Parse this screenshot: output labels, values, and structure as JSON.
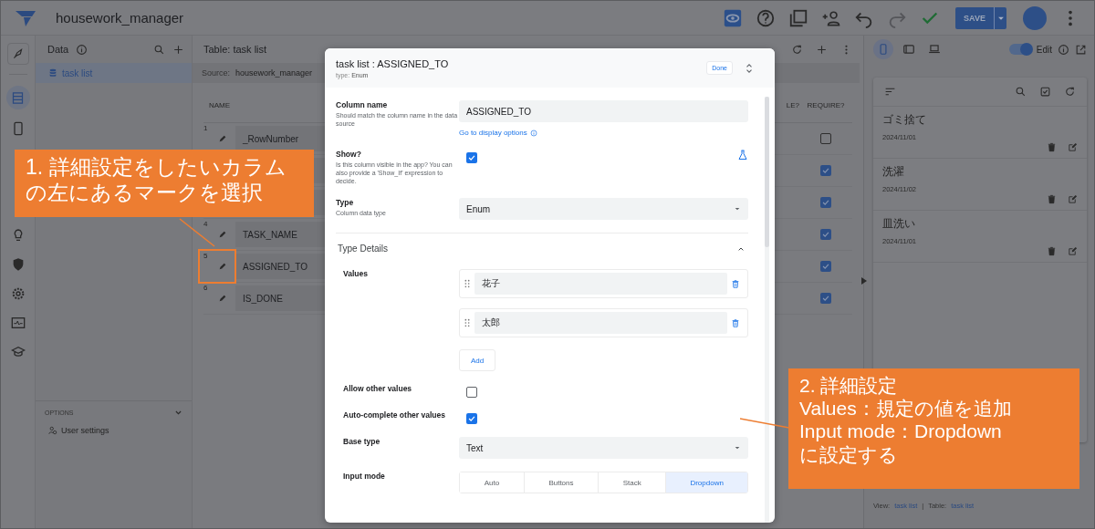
{
  "app": {
    "title": "housework_manager",
    "save_label": "SAVE"
  },
  "data_panel": {
    "title": "Data",
    "tables": [
      {
        "label": "task list",
        "selected": true
      }
    ],
    "options_title": "OPTIONS",
    "options_items": [
      "User settings"
    ]
  },
  "table_panel": {
    "title": "Table: task list",
    "source_label": "Source:",
    "source_value": "housework_manager",
    "columns": [
      "NAME",
      "LE?",
      "REQUIRE?"
    ],
    "rows": [
      {
        "number": "1",
        "name": "_RowNumber",
        "require": false
      },
      {
        "require": true
      },
      {
        "require": true
      },
      {
        "number": "4",
        "name": "TASK_NAME",
        "require": true
      },
      {
        "number": "5",
        "name": "ASSIGNED_TO",
        "require": true
      },
      {
        "number": "6",
        "name": "IS_DONE",
        "require": true
      }
    ]
  },
  "preview": {
    "devices": [
      {
        "kind": "phone",
        "selected": true
      },
      {
        "kind": "tablet",
        "selected": false
      },
      {
        "kind": "laptop",
        "selected": false
      }
    ],
    "edit_on": true,
    "edit_label": "Edit",
    "items": [
      {
        "title": "ゴミ捨て",
        "date": "2024/11/01"
      },
      {
        "title": "洗濯",
        "date": "2024/11/02"
      },
      {
        "title": "皿洗い",
        "date": "2024/11/01"
      }
    ],
    "footer": {
      "view_label": "View:",
      "view_value": "task list",
      "separator": "|",
      "table_label": "Table:",
      "table_value": "task list"
    }
  },
  "dialog": {
    "title": "task list : ASSIGNED_TO",
    "type_label": "type:",
    "type_value": "Enum",
    "done_label": "Done",
    "fields": [
      {
        "kind": "text",
        "label": "Column name",
        "description": "Should match the column name in the data source",
        "value": "ASSIGNED_TO",
        "link": "Go to display options"
      },
      {
        "kind": "checkbox",
        "label": "Show?",
        "description": "Is this column visible in the app? You can also provide a 'Show_If' expression to decide.",
        "checked": true
      },
      {
        "kind": "select",
        "label": "Type",
        "description": "Column data type",
        "value": "Enum"
      }
    ],
    "section": {
      "title": "Type Details",
      "expanded": true,
      "items": [
        {
          "kind": "values",
          "label": "Values",
          "values": [
            "花子",
            "太郎"
          ],
          "add_label": "Add"
        },
        {
          "kind": "checkbox",
          "label": "Allow other values",
          "checked": false
        },
        {
          "kind": "checkbox",
          "label": "Auto-complete other values",
          "checked": true
        },
        {
          "kind": "select",
          "label": "Base type",
          "value": "Text"
        },
        {
          "kind": "segmented",
          "label": "Input mode",
          "options": [
            {
              "label": "Auto",
              "selected": false
            },
            {
              "label": "Buttons",
              "selected": false
            },
            {
              "label": "Stack",
              "selected": false
            },
            {
              "label": "Dropdown",
              "selected": true
            }
          ]
        }
      ]
    }
  },
  "callouts": [
    {
      "lines": [
        "1. 詳細設定をしたいカラム",
        "の左にあるマークを選択"
      ]
    },
    {
      "lines": [
        "2. 詳細設定",
        "Values：規定の値を追加",
        "Input mode：Dropdown",
        "に設定する"
      ]
    }
  ]
}
